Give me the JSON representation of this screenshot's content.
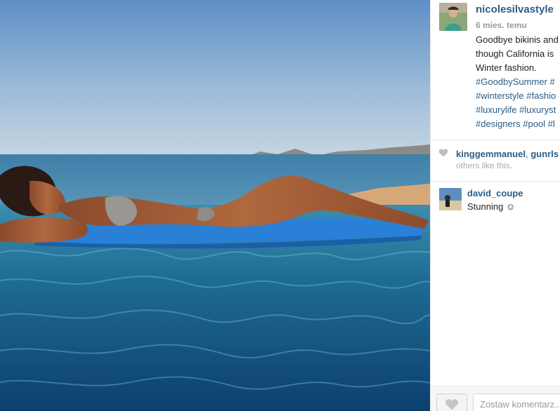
{
  "photo": {
    "description_icon": "photo-image"
  },
  "post": {
    "username": "nicolesilvastyle",
    "timestamp": "6 mies. temu",
    "caption_lines": [
      "Goodbye bikinis and",
      "though California is",
      "Winter fashion."
    ],
    "hashtag_lines": [
      [
        "#GoodbySummer",
        "#"
      ],
      [
        "#winterstyle",
        "#fashio"
      ],
      [
        "#luxurylife",
        "#luxuryst"
      ],
      [
        "#designers",
        "#pool",
        "#l"
      ]
    ]
  },
  "likes": {
    "icon": "heart-icon",
    "users": [
      "kinggemmanuel",
      "gunrls"
    ],
    "separator": ",",
    "others_text": "others like this."
  },
  "comments": [
    {
      "username": "david_coupe",
      "text": "Stunning ☺"
    }
  ],
  "composer": {
    "like_icon": "heart-icon",
    "placeholder": "Zostaw komentarz..."
  },
  "colors": {
    "link": "#2c5d87",
    "muted": "#9a9a9a"
  }
}
